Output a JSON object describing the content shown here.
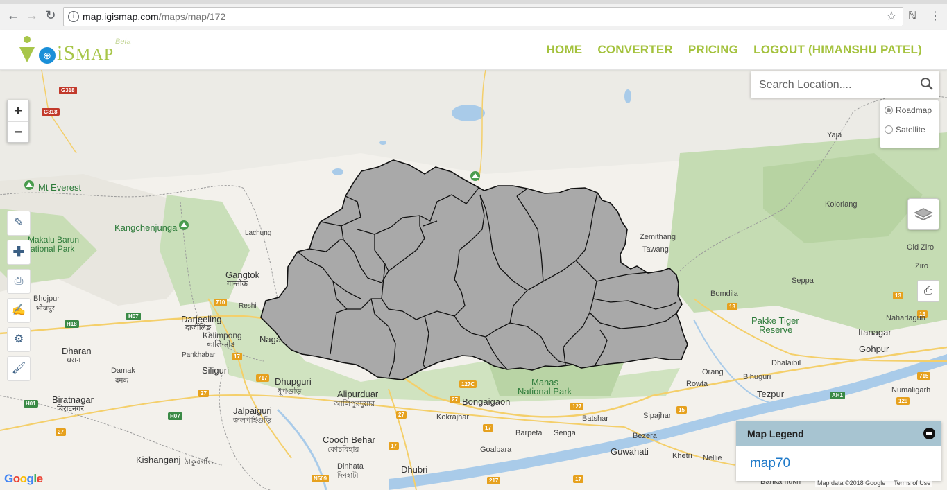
{
  "browser": {
    "url_host": "map.igismap.com",
    "url_path": "/maps/map/172"
  },
  "site": {
    "logo_text_i": "iS",
    "logo_text_map": "MAP",
    "logo_beta": "Beta",
    "nav": {
      "home": "HOME",
      "converter": "CONVERTER",
      "pricing": "PRICING",
      "logout": "LOGOUT (HIMANSHU PATEL)"
    }
  },
  "map": {
    "search_placeholder": "Search Location....",
    "map_types": {
      "roadmap": "Roadmap",
      "satellite": "Satellite",
      "selected": "roadmap"
    },
    "zoom_in": "+",
    "zoom_out": "−",
    "legend": {
      "title": "Map Legend",
      "item": "map70"
    },
    "google_logo": "Google",
    "attribution_data": "Map data ©2018 Google",
    "attribution_terms": "Terms of Use",
    "labels": {
      "mt_everest": "Mt Everest",
      "kangchenjunga": "Kangchenjunga",
      "makalu_1": "Makalu Barun",
      "makalu_2": "ational Park",
      "lachung": "Lachung",
      "gangtok": "Gangtok",
      "gangtok_local": "गान्तोक",
      "reshi": "Reshi",
      "bhojpur": "Bhojpur",
      "bhojpur_local": "भोजपुर",
      "darjeeling": "Darjeeling",
      "darjeeling_local": "दार्जीलिङ",
      "kalimpong": "Kalimpong",
      "kalimpong_local": "कालिम्पोङ",
      "dharan": "Dharan",
      "dharan_local": "धरान",
      "pankhabari": "Pankhabari",
      "siliguri": "Siliguri",
      "damak": "Damak",
      "damak_local": "दमक",
      "biratnagar": "Biratnagar",
      "biratnagar_local": "बिराटनगर",
      "dhupguri": "Dhupguri",
      "dhupguri_local": "ধূপগুড়ি",
      "alipurduar": "Alipurduar",
      "alipurduar_local": "আলিপুরদুয়ার",
      "jalpaiguri": "Jalpaiguri",
      "jalpaiguri_local": "জলপাইগুড়ি",
      "kishanganj": "Kishanganj",
      "kishanganj_local": "ঠাকুরগাঁও",
      "cooch_behar": "Cooch Behar",
      "cooch_behar_local": "কোচবিহার",
      "dhubri": "Dhubri",
      "dinhata": "Dinhata",
      "dinhata_local": "দিনহাটা",
      "bongaigaon": "Bongaigaon",
      "kokrajhar": "Kokrajhar",
      "goalpara": "Goalpara",
      "manas_1": "Manas",
      "manas_2": "National Park",
      "barpeta": "Barpeta",
      "sengा": "Senga",
      "batshar": "Batshar",
      "guwahati": "Guwahati",
      "bezera": "Bezera",
      "sipajhar": "Sipajhar",
      "khetri": "Khetri",
      "nellie": "Nellie",
      "bankamukh": "Bankamukh",
      "tezpur": "Tezpur",
      "rowta": "Rowta",
      "orang": "Orang",
      "bihuguri": "Bihuguri",
      "dhalaibil": "Dhalaibil",
      "gohpur": "Gohpur",
      "numaligarh": "Numaligarh",
      "itanagar": "Itanagar",
      "naharlagun": "Naharlagun",
      "pakke_1": "Pakke Tiger",
      "pakke_2": "Reserve",
      "bomdila": "Bomdila",
      "seppa": "Seppa",
      "tawang": "Tawang",
      "zemithang": "Zemithang",
      "koloriang": "Koloriang",
      "old_ziro": "Old Ziro",
      "ziro": "Ziro",
      "yaja": "Yaja",
      "naga": "Naga"
    }
  }
}
